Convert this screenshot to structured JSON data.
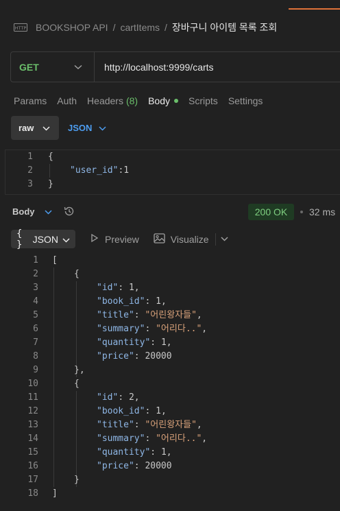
{
  "breadcrumb": {
    "icon": "http-icon",
    "items": [
      "BOOKSHOP API",
      "cartItems"
    ],
    "separator": "/",
    "current": "장바구니 아이템 목록 조회"
  },
  "request": {
    "method": "GET",
    "url": "http://localhost:9999/carts"
  },
  "request_tabs": [
    {
      "label": "Params"
    },
    {
      "label": "Auth"
    },
    {
      "label": "Headers",
      "count": "(8)"
    },
    {
      "label": "Body",
      "active": true
    },
    {
      "label": "Scripts"
    },
    {
      "label": "Settings"
    }
  ],
  "body_options": {
    "mode": "raw",
    "format": "JSON"
  },
  "request_body": {
    "line_numbers": [
      "1",
      "2",
      "3"
    ],
    "open": "{",
    "key": "\"user_id\"",
    "colon": ":",
    "value": "1",
    "close": "}"
  },
  "response": {
    "label": "Body",
    "status": "200 OK",
    "time": "32 ms",
    "format_label": "JSON",
    "braces": "{ }",
    "preview_label": "Preview",
    "visualize_label": "Visualize"
  },
  "response_body": {
    "line_numbers": [
      "1",
      "2",
      "3",
      "4",
      "5",
      "6",
      "7",
      "8",
      "9",
      "10",
      "11",
      "12",
      "13",
      "14",
      "15",
      "16",
      "17",
      "18"
    ],
    "items": [
      {
        "id": "1",
        "book_id": "1",
        "title": "\"어린왕자들\"",
        "summary": "\"어리다..\"",
        "quantity": "1",
        "price": "20000"
      },
      {
        "id": "2",
        "book_id": "1",
        "title": "\"어린왕자들\"",
        "summary": "\"어리다..\"",
        "quantity": "1",
        "price": "20000"
      }
    ],
    "keys": {
      "id": "\"id\"",
      "book_id": "\"book_id\"",
      "title": "\"title\"",
      "summary": "\"summary\"",
      "quantity": "\"quantity\"",
      "price": "\"price\""
    }
  },
  "colors": {
    "accent_orange": "#e0733a",
    "method_green": "#6bbf6b",
    "link_blue": "#4d9df0",
    "status_bg": "#1f3b23",
    "status_text": "#7fd081"
  }
}
